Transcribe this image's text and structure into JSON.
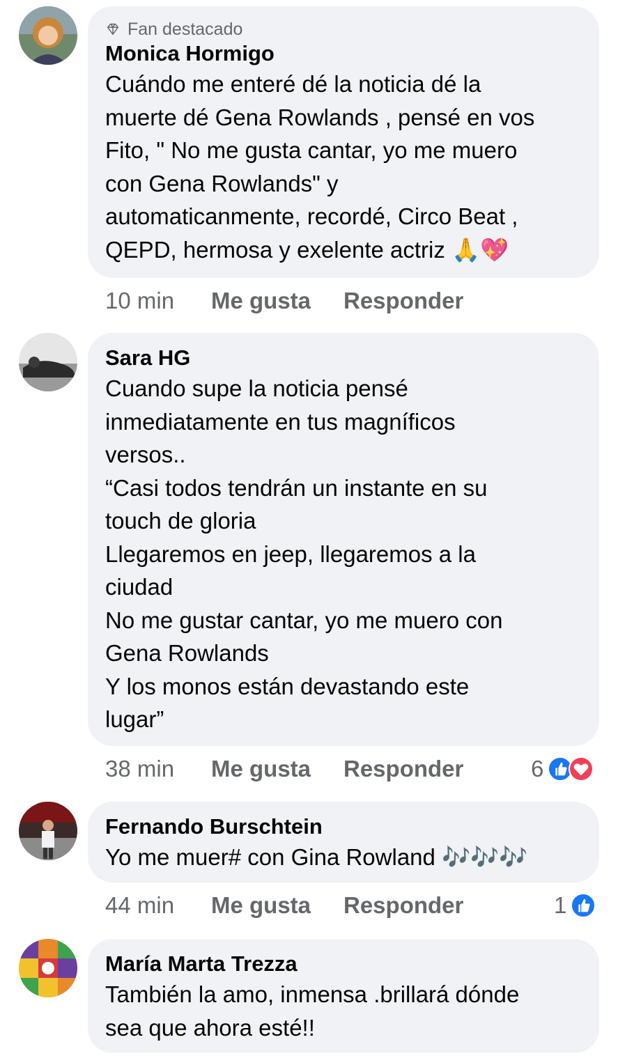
{
  "comments": [
    {
      "badge": "Fan destacado",
      "author": "Monica Hormigo",
      "text": "Cuándo me enteré dé la noticia dé la\nmuerte dé Gena Rowlands , pensé en vos\nFito, \" No me gusta cantar, yo me muero\ncon Gena Rowlands\" y\nautomaticanmente, recordé, Circo Beat ,\nQEPD, hermosa y exelente actriz 🙏💖",
      "time": "10 min",
      "like_label": "Me gusta",
      "reply_label": "Responder",
      "reaction_count": ""
    },
    {
      "author": "Sara HG",
      "text": "Cuando supe la noticia pensé\ninmediatamente en tus magníficos\nversos..\n“Casi todos tendrán un instante en su\ntouch de gloria\nLlegaremos en jeep, llegaremos a la\nciudad\nNo me gustar cantar, yo me muero con\nGena Rowlands\nY los monos están devastando este\nlugar”",
      "time": "38 min",
      "like_label": "Me gusta",
      "reply_label": "Responder",
      "reaction_count": "6"
    },
    {
      "author": "Fernando Burschtein",
      "text": "Yo me muer# con Gina Rowland 🎶🎶🎶",
      "time": "44 min",
      "like_label": "Me gusta",
      "reply_label": "Responder",
      "reaction_count": "1"
    },
    {
      "author": "María Marta Trezza",
      "text": "También la amo, inmensa .brillará dónde\nsea que ahora esté!!"
    }
  ],
  "icons": {
    "badge": "diamond-icon",
    "like_reaction": "like-reaction-icon",
    "love_reaction": "love-reaction-icon"
  },
  "colors": {
    "bubble": "#f0f2f5",
    "secondary_text": "#65676b",
    "like_blue": "#1877f2",
    "love_red": "#f33e58"
  }
}
